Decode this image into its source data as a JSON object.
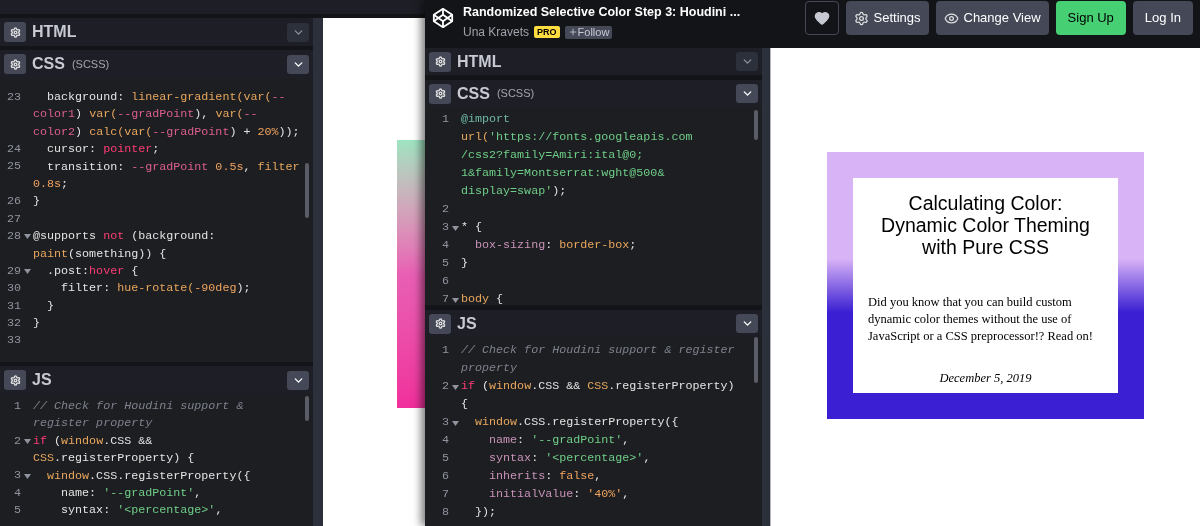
{
  "back_window": {
    "editor": {
      "panels": [
        {
          "title": "HTML",
          "expanded": false
        },
        {
          "title": "CSS",
          "subtitle": "(SCSS)",
          "expanded": true,
          "code": [
            {
              "number": "23",
              "fold": false,
              "tokens": [
                {
                  "kind": "plain",
                  "text": "  background: "
                },
                {
                  "kind": "func",
                  "text": "linear-gradient(var("
                },
                {
                  "kind": "var",
                  "text": "--"
                }
              ]
            },
            {
              "tokens": [
                {
                  "kind": "var",
                  "text": "color1"
                },
                {
                  "kind": "plain",
                  "text": ") "
                },
                {
                  "kind": "func",
                  "text": "var("
                },
                {
                  "kind": "var",
                  "text": "--gradPoint"
                },
                {
                  "kind": "plain",
                  "text": "), "
                },
                {
                  "kind": "func",
                  "text": "var("
                },
                {
                  "kind": "var",
                  "text": "--"
                }
              ]
            },
            {
              "tokens": [
                {
                  "kind": "var",
                  "text": "color2"
                },
                {
                  "kind": "plain",
                  "text": ") "
                },
                {
                  "kind": "func",
                  "text": "calc(var("
                },
                {
                  "kind": "var",
                  "text": "--gradPoint"
                },
                {
                  "kind": "plain",
                  "text": ") + "
                },
                {
                  "kind": "num",
                  "text": "20%"
                },
                {
                  "kind": "plain",
                  "text": "));"
                }
              ]
            },
            {
              "number": "24",
              "fold": false,
              "tokens": [
                {
                  "kind": "plain",
                  "text": "  cursor: "
                },
                {
                  "kind": "kw",
                  "text": "pointer"
                },
                {
                  "kind": "plain",
                  "text": ";"
                }
              ]
            },
            {
              "number": "25",
              "fold": false,
              "tokens": [
                {
                  "kind": "plain",
                  "text": "  transition: "
                },
                {
                  "kind": "var",
                  "text": "--gradPoint"
                },
                {
                  "kind": "num",
                  "text": " 0.5s"
                },
                {
                  "kind": "plain",
                  "text": ", "
                },
                {
                  "kind": "func",
                  "text": "filter"
                }
              ]
            },
            {
              "tokens": [
                {
                  "kind": "num",
                  "text": "0.8s"
                },
                {
                  "kind": "plain",
                  "text": ";"
                }
              ]
            },
            {
              "number": "26",
              "fold": false,
              "tokens": [
                {
                  "kind": "plain",
                  "text": "}"
                }
              ]
            },
            {
              "number": "27",
              "fold": false
            },
            {
              "number": "28",
              "fold": true,
              "tokens": [
                {
                  "kind": "plain",
                  "text": "@supports "
                },
                {
                  "kind": "kw",
                  "text": "not"
                },
                {
                  "kind": "plain",
                  "text": " (background:"
                }
              ]
            },
            {
              "tokens": [
                {
                  "kind": "func",
                  "text": "paint"
                },
                {
                  "kind": "plain",
                  "text": "(something)) {"
                }
              ]
            },
            {
              "number": "29",
              "fold": true,
              "tokens": [
                {
                  "kind": "plain",
                  "text": "  .post:"
                },
                {
                  "kind": "kw",
                  "text": "hover"
                },
                {
                  "kind": "plain",
                  "text": " {"
                }
              ]
            },
            {
              "number": "30",
              "fold": false,
              "tokens": [
                {
                  "kind": "plain",
                  "text": "    filter: "
                },
                {
                  "kind": "func",
                  "text": "hue-rotate("
                },
                {
                  "kind": "num",
                  "text": "-90deg"
                },
                {
                  "kind": "plain",
                  "text": ");"
                }
              ]
            },
            {
              "number": "31",
              "fold": false,
              "tokens": [
                {
                  "kind": "plain",
                  "text": "  }"
                }
              ]
            },
            {
              "number": "32",
              "fold": false,
              "tokens": [
                {
                  "kind": "plain",
                  "text": "}"
                }
              ]
            },
            {
              "number": "33",
              "fold": false
            }
          ]
        },
        {
          "title": "JS",
          "expanded": true,
          "code": [
            {
              "number": "1",
              "fold": false,
              "tokens": [
                {
                  "kind": "comment",
                  "text": "// Check for Houdini support &"
                }
              ]
            },
            {
              "tokens": [
                {
                  "kind": "comment",
                  "text": "register property"
                }
              ]
            },
            {
              "number": "2",
              "fold": true,
              "tokens": [
                {
                  "kind": "kw",
                  "text": "if"
                },
                {
                  "kind": "plain",
                  "text": " ("
                },
                {
                  "kind": "func",
                  "text": "window"
                },
                {
                  "kind": "plain",
                  "text": ".CSS &&"
                }
              ]
            },
            {
              "tokens": [
                {
                  "kind": "func",
                  "text": "CSS"
                },
                {
                  "kind": "plain",
                  "text": ".registerProperty) {"
                }
              ]
            },
            {
              "number": "3",
              "fold": true,
              "tokens": [
                {
                  "kind": "func",
                  "text": "  window"
                },
                {
                  "kind": "plain",
                  "text": ".CSS.registerProperty({"
                }
              ]
            },
            {
              "number": "4",
              "fold": false,
              "tokens": [
                {
                  "kind": "plain",
                  "text": "    name: "
                },
                {
                  "kind": "str",
                  "text": "'--gradPoint'"
                },
                {
                  "kind": "plain",
                  "text": ","
                }
              ]
            },
            {
              "number": "5",
              "fold": false,
              "tokens": [
                {
                  "kind": "plain",
                  "text": "    syntax: "
                },
                {
                  "kind": "str",
                  "text": "'<percentage>'"
                },
                {
                  "kind": "plain",
                  "text": ","
                }
              ]
            }
          ]
        }
      ]
    }
  },
  "front_window": {
    "header": {
      "title": "Randomized Selective Color Step 3: Houdini ...",
      "author": "Una Kravets",
      "badge": "PRO",
      "follow": "Follow",
      "buttons": [
        {
          "kind": "heart"
        },
        {
          "kind": "settings",
          "label": "Settings"
        },
        {
          "kind": "view",
          "label": "Change View"
        },
        {
          "kind": "signup",
          "label": "Sign Up"
        },
        {
          "kind": "login",
          "label": "Log In"
        }
      ]
    },
    "editor": {
      "panels": [
        {
          "title": "HTML",
          "expanded": false
        },
        {
          "title": "CSS",
          "subtitle": "(SCSS)",
          "expanded": true,
          "code": [
            {
              "number": "1",
              "fold": false,
              "tokens": [
                {
                  "kind": "at",
                  "text": "@import"
                }
              ]
            },
            {
              "tokens": [
                {
                  "kind": "func",
                  "text": "url("
                },
                {
                  "kind": "str",
                  "text": "'https://fonts.googleapis.com"
                }
              ]
            },
            {
              "tokens": [
                {
                  "kind": "str",
                  "text": "/css2?family=Amiri:ital@0;"
                }
              ]
            },
            {
              "tokens": [
                {
                  "kind": "str",
                  "text": "1&family=Montserrat:wght@500&"
                }
              ]
            },
            {
              "tokens": [
                {
                  "kind": "str",
                  "text": "display=swap'"
                },
                {
                  "kind": "plain",
                  "text": ");"
                }
              ]
            },
            {
              "number": "2",
              "fold": false
            },
            {
              "number": "3",
              "fold": true,
              "tokens": [
                {
                  "kind": "plain",
                  "text": "* {"
                }
              ]
            },
            {
              "number": "4",
              "fold": false,
              "tokens": [
                {
                  "kind": "prop",
                  "text": "  box-sizing"
                },
                {
                  "kind": "plain",
                  "text": ": "
                },
                {
                  "kind": "func",
                  "text": "border-box"
                },
                {
                  "kind": "plain",
                  "text": ";"
                }
              ]
            },
            {
              "number": "5",
              "fold": false,
              "tokens": [
                {
                  "kind": "plain",
                  "text": "}"
                }
              ]
            },
            {
              "number": "6",
              "fold": false
            },
            {
              "number": "7",
              "fold": true,
              "tokens": [
                {
                  "kind": "func",
                  "text": "body"
                },
                {
                  "kind": "plain",
                  "text": " {"
                }
              ]
            }
          ]
        },
        {
          "title": "JS",
          "expanded": true,
          "code": [
            {
              "number": "1",
              "fold": false,
              "tokens": [
                {
                  "kind": "comment",
                  "text": "// Check for Houdini support & register"
                }
              ]
            },
            {
              "tokens": [
                {
                  "kind": "comment",
                  "text": "property"
                }
              ]
            },
            {
              "number": "2",
              "fold": true,
              "tokens": [
                {
                  "kind": "kw",
                  "text": "if"
                },
                {
                  "kind": "plain",
                  "text": " ("
                },
                {
                  "kind": "func",
                  "text": "window"
                },
                {
                  "kind": "plain",
                  "text": ".CSS && "
                },
                {
                  "kind": "func",
                  "text": "CSS"
                },
                {
                  "kind": "plain",
                  "text": ".registerProperty)"
                }
              ]
            },
            {
              "tokens": [
                {
                  "kind": "plain",
                  "text": "{"
                }
              ]
            },
            {
              "number": "3",
              "fold": true,
              "tokens": [
                {
                  "kind": "func",
                  "text": "  window"
                },
                {
                  "kind": "plain",
                  "text": ".CSS.registerProperty({"
                }
              ]
            },
            {
              "number": "4",
              "fold": false,
              "tokens": [
                {
                  "kind": "prop",
                  "text": "    name"
                },
                {
                  "kind": "plain",
                  "text": ": "
                },
                {
                  "kind": "str",
                  "text": "'--gradPoint'"
                },
                {
                  "kind": "plain",
                  "text": ","
                }
              ]
            },
            {
              "number": "5",
              "fold": false,
              "tokens": [
                {
                  "kind": "prop",
                  "text": "    syntax"
                },
                {
                  "kind": "plain",
                  "text": ": "
                },
                {
                  "kind": "str",
                  "text": "'<percentage>'"
                },
                {
                  "kind": "plain",
                  "text": ","
                }
              ]
            },
            {
              "number": "6",
              "fold": false,
              "tokens": [
                {
                  "kind": "prop",
                  "text": "    inherits"
                },
                {
                  "kind": "plain",
                  "text": ": "
                },
                {
                  "kind": "num",
                  "text": "false"
                },
                {
                  "kind": "plain",
                  "text": ","
                }
              ]
            },
            {
              "number": "7",
              "fold": false,
              "tokens": [
                {
                  "kind": "prop",
                  "text": "    initialValue"
                },
                {
                  "kind": "plain",
                  "text": ": "
                },
                {
                  "kind": "num",
                  "text": "'40%'"
                },
                {
                  "kind": "plain",
                  "text": ","
                }
              ]
            },
            {
              "number": "8",
              "fold": false,
              "tokens": [
                {
                  "kind": "plain",
                  "text": "  });"
                }
              ]
            }
          ]
        }
      ]
    },
    "preview": {
      "title": "Calculating Color: Dynamic Color Theming with Pure CSS",
      "body": "Did you know that you can build custom dynamic color themes without the use of JavaScript or a CSS preprocessor!? Read on!",
      "date": "December 5, 2019"
    }
  }
}
